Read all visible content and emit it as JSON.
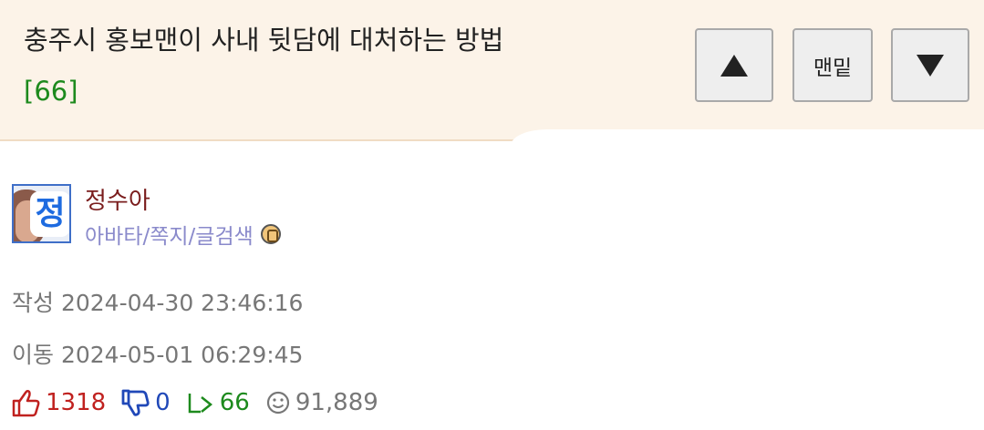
{
  "post": {
    "title": "충주시 홍보맨이 사내 뒷담에 대처하는 방법",
    "comment_count": "[66]"
  },
  "nav": {
    "up_icon": "triangle-up-icon",
    "bottom_label": "맨밑",
    "down_icon": "triangle-down-icon"
  },
  "author": {
    "avatar_char": "정",
    "nickname": "정수아",
    "links": "아바타/쪽지/글검색"
  },
  "meta": {
    "created": "작성 2024-04-30 23:46:16",
    "moved": "이동 2024-05-01 06:29:45"
  },
  "stats": {
    "upvotes": "1318",
    "downvotes": "0",
    "replies": "66",
    "views": "91,889"
  },
  "colors": {
    "header_bg": "#fcf3e8",
    "comment_green": "#1d8a1d",
    "nickname": "#7a1d1d",
    "link_purple": "#8a8acb",
    "up_red": "#c0211f",
    "down_blue": "#2048b8"
  }
}
